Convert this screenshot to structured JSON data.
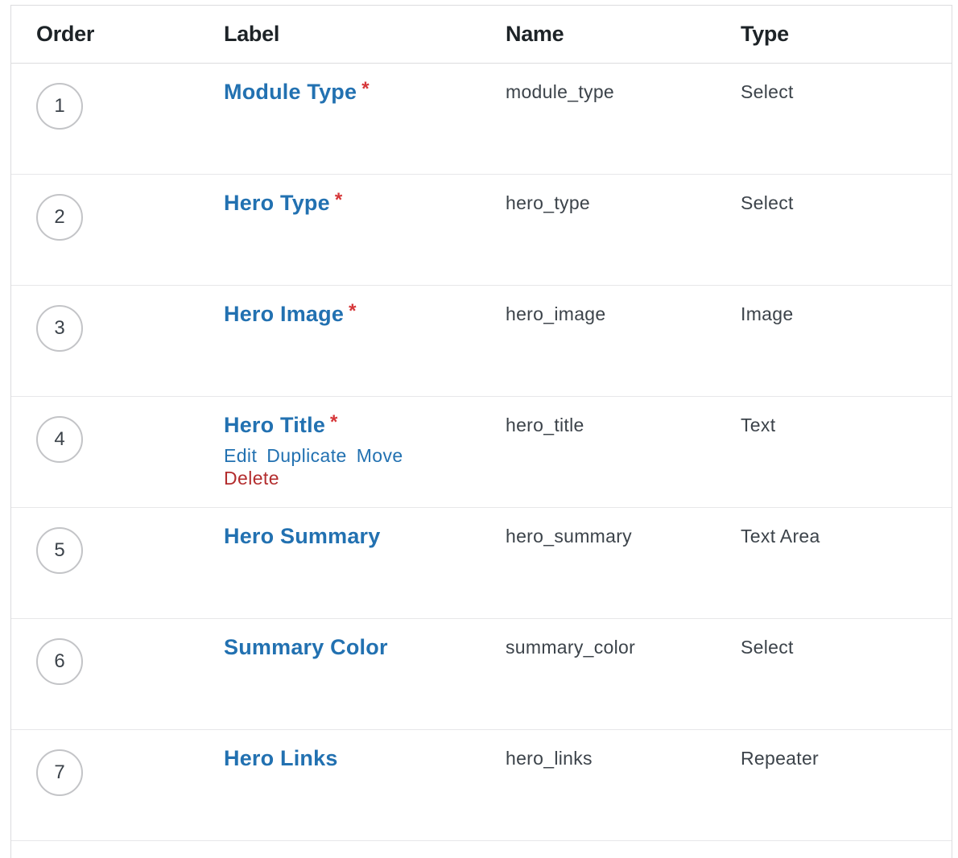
{
  "header": {
    "order": "Order",
    "label": "Label",
    "name": "Name",
    "type": "Type"
  },
  "rows": [
    {
      "order": "1",
      "label": "Module Type",
      "required": "*",
      "name": "module_type",
      "type": "Select"
    },
    {
      "order": "2",
      "label": "Hero Type",
      "required": "*",
      "name": "hero_type",
      "type": "Select"
    },
    {
      "order": "3",
      "label": "Hero Image",
      "required": "*",
      "name": "hero_image",
      "type": "Image"
    },
    {
      "order": "4",
      "label": "Hero Title",
      "required": "*",
      "name": "hero_title",
      "type": "Text",
      "actions": {
        "edit": "Edit",
        "duplicate": "Duplicate",
        "move": "Move",
        "delete": "Delete"
      }
    },
    {
      "order": "5",
      "label": "Hero Summary",
      "name": "hero_summary",
      "type": "Text Area"
    },
    {
      "order": "6",
      "label": "Summary Color",
      "name": "summary_color",
      "type": "Select"
    },
    {
      "order": "7",
      "label": "Hero Links",
      "name": "hero_links",
      "type": "Repeater"
    }
  ],
  "colors": {
    "link": "#2271b1",
    "required": "#d63638",
    "delete": "#b32d2e",
    "border": "#dcdcde"
  }
}
